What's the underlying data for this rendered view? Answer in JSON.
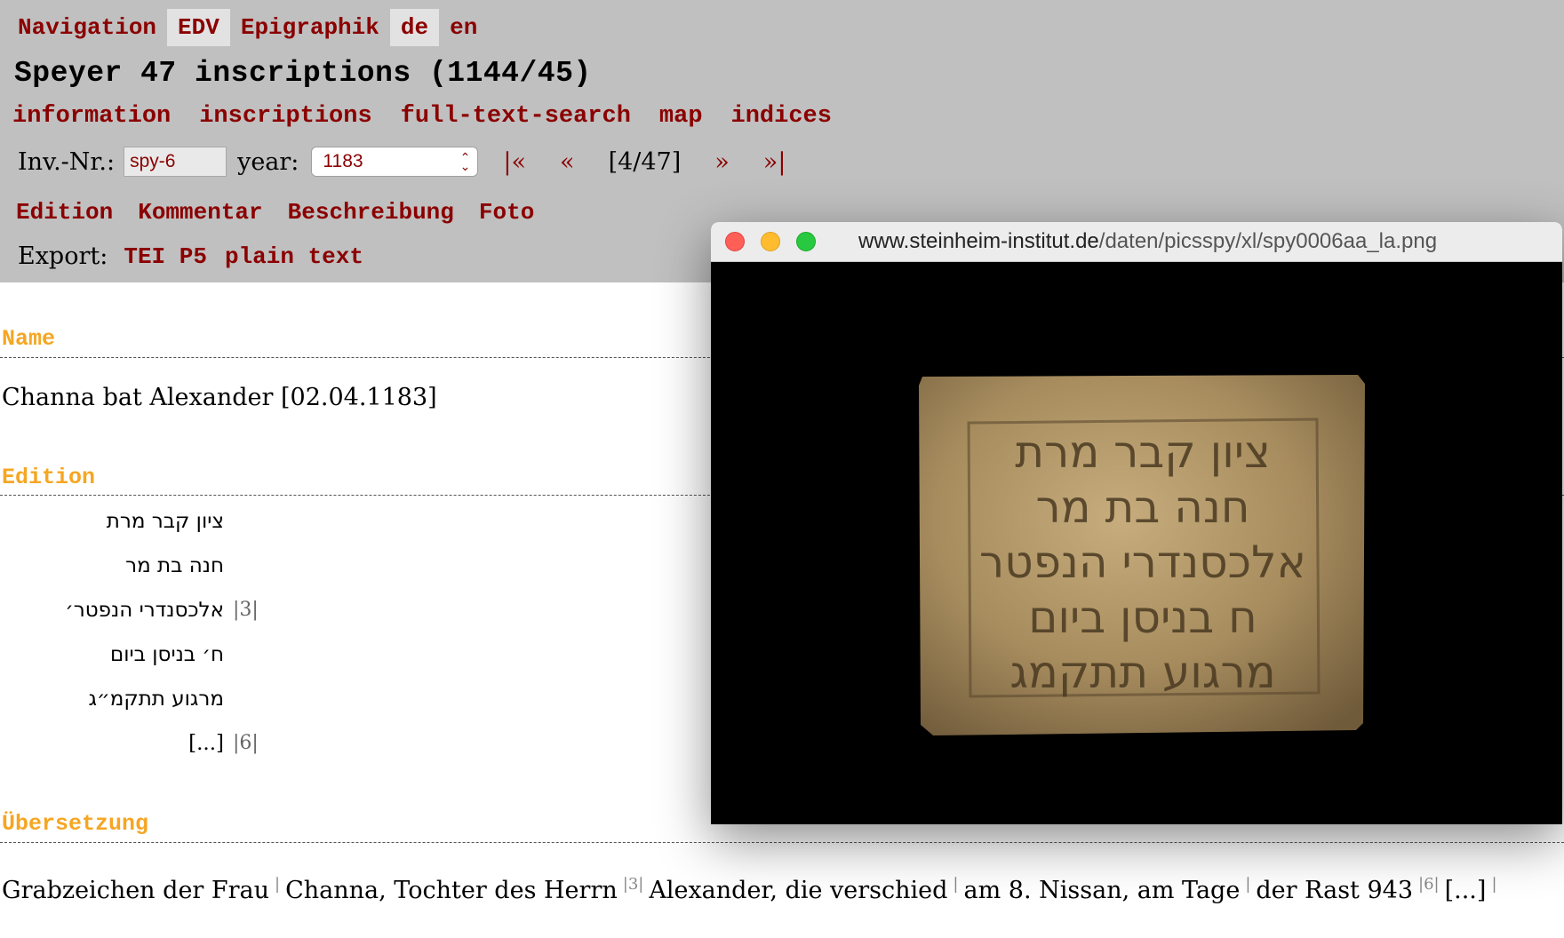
{
  "topnav": {
    "navigation": "Navigation",
    "edv": "EDV",
    "epigraphik": "Epigraphik",
    "lang_de": "de",
    "lang_en": "en"
  },
  "page_title": "Speyer 47 inscriptions (1144/45)",
  "subnav": [
    "information",
    "inscriptions",
    "full-text-search",
    "map",
    "indices"
  ],
  "controls": {
    "inv_label": "Inv.-Nr.:",
    "inv_value": "spy-6",
    "year_label": "year:",
    "year_value": "1183",
    "first": "|«",
    "prev": "«",
    "position": "[4/47]",
    "next": "»",
    "last": "»|"
  },
  "sections_nav": [
    "Edition",
    "Kommentar",
    "Beschreibung",
    "Foto"
  ],
  "export": {
    "label": "Export:",
    "tei": "TEI P5",
    "plain": "plain text"
  },
  "name": {
    "heading": "Name",
    "text": "Channa bat Alexander [02.04.1183]"
  },
  "edition": {
    "heading": "Edition",
    "lines": [
      {
        "text": "ציון קבר מרת",
        "num": ""
      },
      {
        "text": "חנה בת מר",
        "num": ""
      },
      {
        "text": "אלכסנדרי הנפטר׳",
        "num": "|3|"
      },
      {
        "text": "ח׳ בניסן ביום",
        "num": ""
      },
      {
        "text": "מרגוע תתקמ״ג",
        "num": ""
      },
      {
        "text": "[...]",
        "num": "|6|"
      }
    ]
  },
  "translation": {
    "heading": "Übersetzung",
    "segments": [
      {
        "text": "Grabzeichen der Frau",
        "sep": "|"
      },
      {
        "text": "Channa, Tochter des Herrn",
        "sep": "|3|"
      },
      {
        "text": "Alexander, die verschied",
        "sep": "|"
      },
      {
        "text": "am 8. Nissan, am Tage",
        "sep": "|"
      },
      {
        "text": "der Rast 943",
        "sep": "|6|"
      },
      {
        "text": "[...]",
        "sep": "|"
      }
    ]
  },
  "image_window": {
    "url_host": "www.steinheim-institut.de",
    "url_path": "/daten/picsspy/xl/spy0006aa_la.png",
    "stone_lines": [
      "ציון קבר מרת",
      "חנה בת מר",
      "אלכסנדרי הנפטר",
      "ח בניסן ביום",
      "מרגוע תתקמג"
    ]
  },
  "colors": {
    "header_bg": "#c0c0c0",
    "link": "#8b0000",
    "section_heading": "#f5a623",
    "stone": "#b39a6c"
  }
}
